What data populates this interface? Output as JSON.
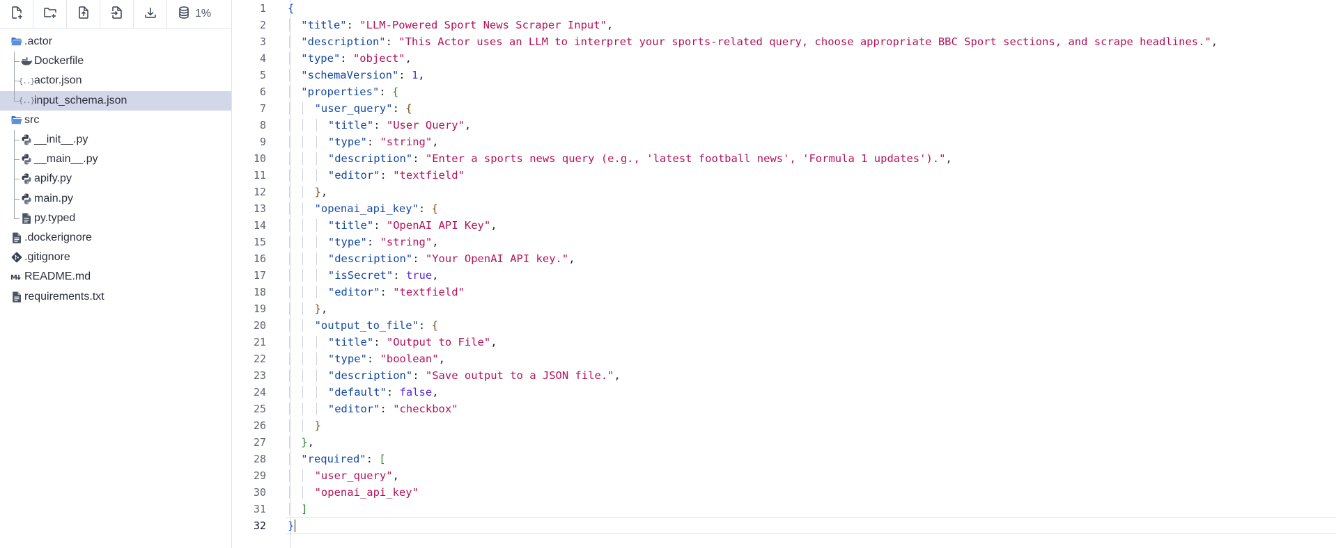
{
  "toolbar": {
    "buttons": [
      "new-file",
      "new-folder",
      "upload-file",
      "import-file",
      "download"
    ],
    "storage_label": "1%"
  },
  "tree": {
    "items": [
      {
        "label": ".actor",
        "type": "folder-open"
      },
      {
        "label": "Dockerfile",
        "type": "docker"
      },
      {
        "label": "actor.json",
        "type": "json"
      },
      {
        "label": "input_schema.json",
        "type": "json",
        "selected": true
      },
      {
        "label": "src",
        "type": "folder-open"
      },
      {
        "label": "__init__.py",
        "type": "python"
      },
      {
        "label": "__main__.py",
        "type": "python"
      },
      {
        "label": "apify.py",
        "type": "python"
      },
      {
        "label": "main.py",
        "type": "python"
      },
      {
        "label": "py.typed",
        "type": "file"
      },
      {
        "label": ".dockerignore",
        "type": "file"
      },
      {
        "label": ".gitignore",
        "type": "git"
      },
      {
        "label": "README.md",
        "type": "markdown"
      },
      {
        "label": "requirements.txt",
        "type": "file"
      }
    ]
  },
  "editor": {
    "active_line": 32,
    "lines": [
      {
        "no": "1",
        "indent": 0,
        "t": [
          [
            "{",
            "b1"
          ]
        ]
      },
      {
        "no": "2",
        "indent": 1,
        "t": [
          [
            "\"title\"",
            "k"
          ],
          [
            ": ",
            "p"
          ],
          [
            "\"LLM-Powered Sport News Scraper Input\"",
            "s"
          ],
          [
            ",",
            "p"
          ]
        ]
      },
      {
        "no": "3",
        "indent": 1,
        "t": [
          [
            "\"description\"",
            "k"
          ],
          [
            ": ",
            "p"
          ],
          [
            "\"This Actor uses an LLM to interpret your sports-related query, choose appropriate BBC Sport sections, and scrape headlines.\"",
            "s"
          ],
          [
            ",",
            "p"
          ]
        ]
      },
      {
        "no": "4",
        "indent": 1,
        "t": [
          [
            "\"type\"",
            "k"
          ],
          [
            ": ",
            "p"
          ],
          [
            "\"object\"",
            "s"
          ],
          [
            ",",
            "p"
          ]
        ]
      },
      {
        "no": "5",
        "indent": 1,
        "t": [
          [
            "\"schemaVersion\"",
            "k"
          ],
          [
            ": ",
            "p"
          ],
          [
            "1",
            "n"
          ],
          [
            ",",
            "p"
          ]
        ]
      },
      {
        "no": "6",
        "indent": 1,
        "t": [
          [
            "\"properties\"",
            "k"
          ],
          [
            ": ",
            "p"
          ],
          [
            "{",
            "b2"
          ]
        ]
      },
      {
        "no": "7",
        "indent": 2,
        "t": [
          [
            "\"user_query\"",
            "k"
          ],
          [
            ": ",
            "p"
          ],
          [
            "{",
            "b3"
          ]
        ]
      },
      {
        "no": "8",
        "indent": 3,
        "t": [
          [
            "\"title\"",
            "k"
          ],
          [
            ": ",
            "p"
          ],
          [
            "\"User Query\"",
            "s"
          ],
          [
            ",",
            "p"
          ]
        ]
      },
      {
        "no": "9",
        "indent": 3,
        "t": [
          [
            "\"type\"",
            "k"
          ],
          [
            ": ",
            "p"
          ],
          [
            "\"string\"",
            "s"
          ],
          [
            ",",
            "p"
          ]
        ]
      },
      {
        "no": "10",
        "indent": 3,
        "t": [
          [
            "\"description\"",
            "k"
          ],
          [
            ": ",
            "p"
          ],
          [
            "\"Enter a sports news query (e.g., 'latest football news', 'Formula 1 updates').\"",
            "s"
          ],
          [
            ",",
            "p"
          ]
        ]
      },
      {
        "no": "11",
        "indent": 3,
        "t": [
          [
            "\"editor\"",
            "k"
          ],
          [
            ": ",
            "p"
          ],
          [
            "\"textfield\"",
            "s"
          ]
        ]
      },
      {
        "no": "12",
        "indent": 2,
        "t": [
          [
            "}",
            "b3"
          ],
          [
            ",",
            "p"
          ]
        ]
      },
      {
        "no": "13",
        "indent": 2,
        "t": [
          [
            "\"openai_api_key\"",
            "k"
          ],
          [
            ": ",
            "p"
          ],
          [
            "{",
            "b3"
          ]
        ]
      },
      {
        "no": "14",
        "indent": 3,
        "t": [
          [
            "\"title\"",
            "k"
          ],
          [
            ": ",
            "p"
          ],
          [
            "\"OpenAI API Key\"",
            "s"
          ],
          [
            ",",
            "p"
          ]
        ]
      },
      {
        "no": "15",
        "indent": 3,
        "t": [
          [
            "\"type\"",
            "k"
          ],
          [
            ": ",
            "p"
          ],
          [
            "\"string\"",
            "s"
          ],
          [
            ",",
            "p"
          ]
        ]
      },
      {
        "no": "16",
        "indent": 3,
        "t": [
          [
            "\"description\"",
            "k"
          ],
          [
            ": ",
            "p"
          ],
          [
            "\"Your OpenAI API key.\"",
            "s"
          ],
          [
            ",",
            "p"
          ]
        ]
      },
      {
        "no": "17",
        "indent": 3,
        "t": [
          [
            "\"isSecret\"",
            "k"
          ],
          [
            ": ",
            "p"
          ],
          [
            "true",
            "bl"
          ],
          [
            ",",
            "p"
          ]
        ]
      },
      {
        "no": "18",
        "indent": 3,
        "t": [
          [
            "\"editor\"",
            "k"
          ],
          [
            ": ",
            "p"
          ],
          [
            "\"textfield\"",
            "s"
          ]
        ]
      },
      {
        "no": "19",
        "indent": 2,
        "t": [
          [
            "}",
            "b3"
          ],
          [
            ",",
            "p"
          ]
        ]
      },
      {
        "no": "20",
        "indent": 2,
        "t": [
          [
            "\"output_to_file\"",
            "k"
          ],
          [
            ": ",
            "p"
          ],
          [
            "{",
            "b3"
          ]
        ]
      },
      {
        "no": "21",
        "indent": 3,
        "t": [
          [
            "\"title\"",
            "k"
          ],
          [
            ": ",
            "p"
          ],
          [
            "\"Output to File\"",
            "s"
          ],
          [
            ",",
            "p"
          ]
        ]
      },
      {
        "no": "22",
        "indent": 3,
        "t": [
          [
            "\"type\"",
            "k"
          ],
          [
            ": ",
            "p"
          ],
          [
            "\"boolean\"",
            "s"
          ],
          [
            ",",
            "p"
          ]
        ]
      },
      {
        "no": "23",
        "indent": 3,
        "t": [
          [
            "\"description\"",
            "k"
          ],
          [
            ": ",
            "p"
          ],
          [
            "\"Save output to a JSON file.\"",
            "s"
          ],
          [
            ",",
            "p"
          ]
        ]
      },
      {
        "no": "24",
        "indent": 3,
        "t": [
          [
            "\"default\"",
            "k"
          ],
          [
            ": ",
            "p"
          ],
          [
            "false",
            "bl"
          ],
          [
            ",",
            "p"
          ]
        ]
      },
      {
        "no": "25",
        "indent": 3,
        "t": [
          [
            "\"editor\"",
            "k"
          ],
          [
            ": ",
            "p"
          ],
          [
            "\"checkbox\"",
            "s"
          ]
        ]
      },
      {
        "no": "26",
        "indent": 2,
        "t": [
          [
            "}",
            "b3"
          ]
        ]
      },
      {
        "no": "27",
        "indent": 1,
        "t": [
          [
            "}",
            "b2"
          ],
          [
            ",",
            "p"
          ]
        ]
      },
      {
        "no": "28",
        "indent": 1,
        "t": [
          [
            "\"required\"",
            "k"
          ],
          [
            ": ",
            "p"
          ],
          [
            "[",
            "b2"
          ]
        ]
      },
      {
        "no": "29",
        "indent": 2,
        "t": [
          [
            "\"user_query\"",
            "s"
          ],
          [
            ",",
            "p"
          ]
        ]
      },
      {
        "no": "30",
        "indent": 2,
        "t": [
          [
            "\"openai_api_key\"",
            "s"
          ]
        ]
      },
      {
        "no": "31",
        "indent": 1,
        "t": [
          [
            "]",
            "b2"
          ]
        ]
      },
      {
        "no": "32",
        "indent": 0,
        "t": [
          [
            "}",
            "b1"
          ]
        ]
      }
    ]
  }
}
